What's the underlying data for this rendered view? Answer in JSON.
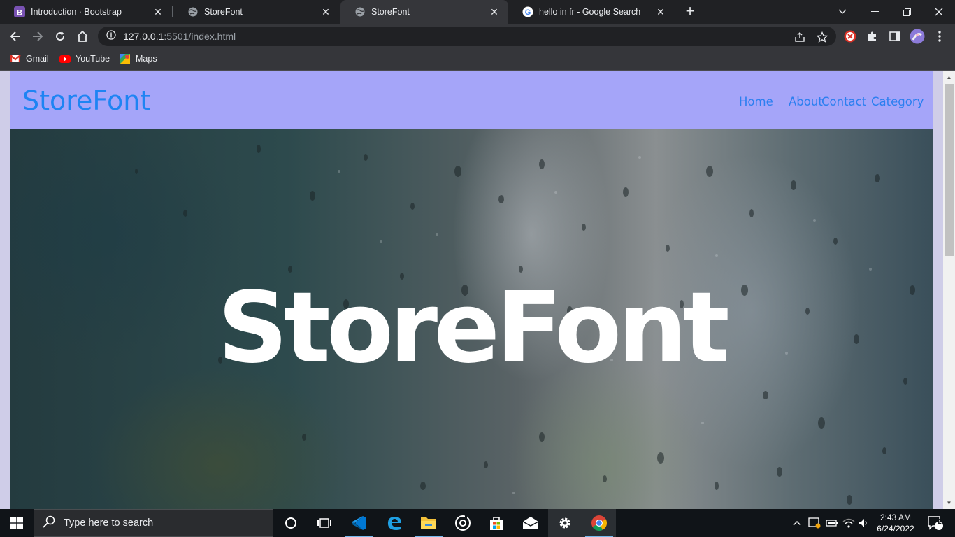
{
  "browser": {
    "tabs": [
      {
        "title": "Introduction · Bootstrap",
        "favicon": "bootstrap-icon"
      },
      {
        "title": "StoreFont",
        "favicon": "globe-icon"
      },
      {
        "title": "StoreFont",
        "favicon": "globe-icon",
        "active": true
      },
      {
        "title": "hello in fr - Google Search",
        "favicon": "google-icon"
      }
    ],
    "address": {
      "host": "127.0.0.1",
      "path": ":5501/index.html"
    },
    "bookmarks": [
      {
        "label": "Gmail",
        "icon": "gmail-icon"
      },
      {
        "label": "YouTube",
        "icon": "youtube-icon"
      },
      {
        "label": "Maps",
        "icon": "maps-icon"
      }
    ]
  },
  "page": {
    "brand": "StoreFont",
    "nav": [
      "Home",
      "About",
      "Contact",
      "Category"
    ],
    "hero_title": "StoreFont",
    "colors": {
      "navbar_bg": "#a5a5f9",
      "brand": "#1e84f3",
      "nav_link": "#2b7ff0"
    }
  },
  "taskbar": {
    "search_placeholder": "Type here to search",
    "time": "2:43 AM",
    "date": "6/24/2022",
    "notification_count": "2"
  }
}
